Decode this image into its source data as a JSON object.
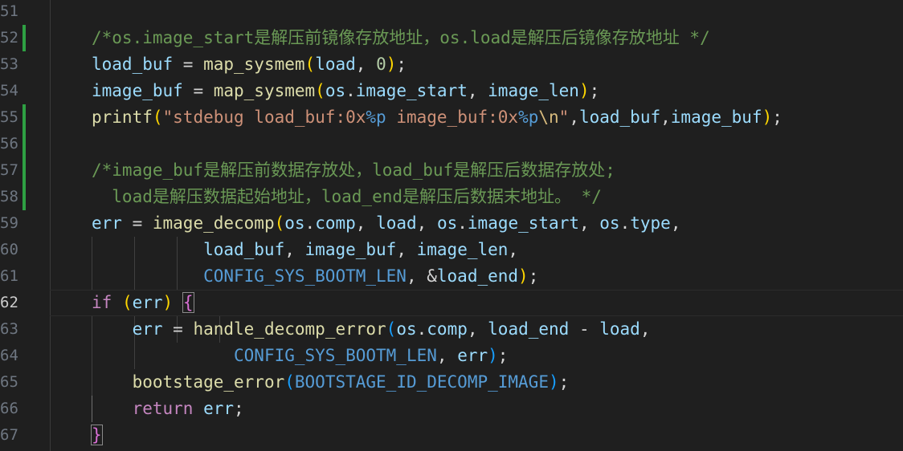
{
  "colors": {
    "background": "#1f1f1f",
    "line_number": "#6e7681",
    "line_number_active": "#cccccc",
    "git_added": "#2ea043",
    "variable": "#9cdcfe",
    "function": "#dcdcaa",
    "string": "#ce9178",
    "comment": "#6a9955",
    "keyword": "#c586c0",
    "macro": "#4fc1ff"
  },
  "editor": {
    "lines": [
      {
        "number": "51",
        "tokens": []
      },
      {
        "number": "52",
        "git_added": true,
        "tokens": [
          {
            "text": "/*os.image_start是解压前镜像存放地址，os.load是解压后镜像存放地址 */",
            "cls": "t-com"
          }
        ]
      },
      {
        "number": "53",
        "tokens": [
          {
            "text": "load_buf",
            "cls": "t-var"
          },
          {
            "text": " = ",
            "cls": "t-op"
          },
          {
            "text": "map_sysmem",
            "cls": "t-fn"
          },
          {
            "text": "(",
            "cls": "t-p1"
          },
          {
            "text": "load",
            "cls": "t-var"
          },
          {
            "text": ", ",
            "cls": "t-op"
          },
          {
            "text": "0",
            "cls": "t-num"
          },
          {
            "text": ")",
            "cls": "t-p1"
          },
          {
            "text": ";",
            "cls": "t-op"
          }
        ]
      },
      {
        "number": "54",
        "tokens": [
          {
            "text": "image_buf",
            "cls": "t-var"
          },
          {
            "text": " = ",
            "cls": "t-op"
          },
          {
            "text": "map_sysmem",
            "cls": "t-fn"
          },
          {
            "text": "(",
            "cls": "t-p1"
          },
          {
            "text": "os",
            "cls": "t-var"
          },
          {
            "text": ".",
            "cls": "t-op"
          },
          {
            "text": "image_start",
            "cls": "t-var"
          },
          {
            "text": ", ",
            "cls": "t-op"
          },
          {
            "text": "image_len",
            "cls": "t-var"
          },
          {
            "text": ")",
            "cls": "t-p1"
          },
          {
            "text": ";",
            "cls": "t-op"
          }
        ]
      },
      {
        "number": "55",
        "git_added": true,
        "tokens": [
          {
            "text": "printf",
            "cls": "t-fn"
          },
          {
            "text": "(",
            "cls": "t-p1"
          },
          {
            "text": "\"stdebug load_buf:0x",
            "cls": "t-str"
          },
          {
            "text": "%p",
            "cls": "t-macro"
          },
          {
            "text": " image_buf:0x",
            "cls": "t-str"
          },
          {
            "text": "%p",
            "cls": "t-macro"
          },
          {
            "text": "\\n",
            "cls": "t-esc"
          },
          {
            "text": "\"",
            "cls": "t-str"
          },
          {
            "text": ",",
            "cls": "t-op"
          },
          {
            "text": "load_buf",
            "cls": "t-var"
          },
          {
            "text": ",",
            "cls": "t-op"
          },
          {
            "text": "image_buf",
            "cls": "t-var"
          },
          {
            "text": ")",
            "cls": "t-p1"
          },
          {
            "text": ";",
            "cls": "t-op"
          }
        ]
      },
      {
        "number": "56",
        "git_added": true,
        "tokens": []
      },
      {
        "number": "57",
        "git_added": true,
        "tokens": [
          {
            "text": "/*image_buf是解压前数据存放处，load_buf是解压后数据存放处;",
            "cls": "t-com"
          }
        ]
      },
      {
        "number": "58",
        "git_added": true,
        "tokens": [
          {
            "text": "  load是解压数据起始地址，load_end是解压后数据末地址。 */",
            "cls": "t-com"
          }
        ]
      },
      {
        "number": "59",
        "tokens": [
          {
            "text": "err",
            "cls": "t-var"
          },
          {
            "text": " = ",
            "cls": "t-op"
          },
          {
            "text": "image_decomp",
            "cls": "t-fn"
          },
          {
            "text": "(",
            "cls": "t-p1"
          },
          {
            "text": "os",
            "cls": "t-var"
          },
          {
            "text": ".",
            "cls": "t-op"
          },
          {
            "text": "comp",
            "cls": "t-var"
          },
          {
            "text": ", ",
            "cls": "t-op"
          },
          {
            "text": "load",
            "cls": "t-var"
          },
          {
            "text": ", ",
            "cls": "t-op"
          },
          {
            "text": "os",
            "cls": "t-var"
          },
          {
            "text": ".",
            "cls": "t-op"
          },
          {
            "text": "image_start",
            "cls": "t-var"
          },
          {
            "text": ", ",
            "cls": "t-op"
          },
          {
            "text": "os",
            "cls": "t-var"
          },
          {
            "text": ".",
            "cls": "t-op"
          },
          {
            "text": "type",
            "cls": "t-var"
          },
          {
            "text": ",",
            "cls": "t-op"
          }
        ]
      },
      {
        "number": "60",
        "tokens": [
          {
            "text": "           ",
            "cls": "t-op"
          },
          {
            "text": "load_buf",
            "cls": "t-var"
          },
          {
            "text": ", ",
            "cls": "t-op"
          },
          {
            "text": "image_buf",
            "cls": "t-var"
          },
          {
            "text": ", ",
            "cls": "t-op"
          },
          {
            "text": "image_len",
            "cls": "t-var"
          },
          {
            "text": ",",
            "cls": "t-op"
          }
        ]
      },
      {
        "number": "61",
        "tokens": [
          {
            "text": "           ",
            "cls": "t-op"
          },
          {
            "text": "CONFIG_SYS_BOOTM_LEN",
            "cls": "t-macro"
          },
          {
            "text": ", &",
            "cls": "t-op"
          },
          {
            "text": "load_end",
            "cls": "t-var"
          },
          {
            "text": ")",
            "cls": "t-p1"
          },
          {
            "text": ";",
            "cls": "t-op"
          }
        ]
      },
      {
        "number": "62",
        "current": true,
        "tokens": [
          {
            "text": "if",
            "cls": "t-kw"
          },
          {
            "text": " ",
            "cls": "t-op"
          },
          {
            "text": "(",
            "cls": "t-p1"
          },
          {
            "text": "err",
            "cls": "t-var"
          },
          {
            "text": ")",
            "cls": "t-p1"
          },
          {
            "text": " ",
            "cls": "t-op"
          },
          {
            "text": "{",
            "cls": "t-p2",
            "match": true
          }
        ]
      },
      {
        "number": "63",
        "tokens": [
          {
            "text": "    ",
            "cls": "t-op"
          },
          {
            "text": "err",
            "cls": "t-var"
          },
          {
            "text": " = ",
            "cls": "t-op"
          },
          {
            "text": "handle_decomp_error",
            "cls": "t-fn"
          },
          {
            "text": "(",
            "cls": "t-p3"
          },
          {
            "text": "os",
            "cls": "t-var"
          },
          {
            "text": ".",
            "cls": "t-op"
          },
          {
            "text": "comp",
            "cls": "t-var"
          },
          {
            "text": ", ",
            "cls": "t-op"
          },
          {
            "text": "load_end",
            "cls": "t-var"
          },
          {
            "text": " - ",
            "cls": "t-op"
          },
          {
            "text": "load",
            "cls": "t-var"
          },
          {
            "text": ",",
            "cls": "t-op"
          }
        ]
      },
      {
        "number": "64",
        "tokens": [
          {
            "text": "              ",
            "cls": "t-op"
          },
          {
            "text": "CONFIG_SYS_BOOTM_LEN",
            "cls": "t-macro"
          },
          {
            "text": ", ",
            "cls": "t-op"
          },
          {
            "text": "err",
            "cls": "t-var"
          },
          {
            "text": ")",
            "cls": "t-p3"
          },
          {
            "text": ";",
            "cls": "t-op"
          }
        ]
      },
      {
        "number": "65",
        "tokens": [
          {
            "text": "    ",
            "cls": "t-op"
          },
          {
            "text": "bootstage_error",
            "cls": "t-fn"
          },
          {
            "text": "(",
            "cls": "t-p3"
          },
          {
            "text": "BOOTSTAGE_ID_DECOMP_IMAGE",
            "cls": "t-macro"
          },
          {
            "text": ")",
            "cls": "t-p3"
          },
          {
            "text": ";",
            "cls": "t-op"
          }
        ]
      },
      {
        "number": "66",
        "tokens": [
          {
            "text": "    ",
            "cls": "t-op"
          },
          {
            "text": "return",
            "cls": "t-kw"
          },
          {
            "text": " ",
            "cls": "t-op"
          },
          {
            "text": "err",
            "cls": "t-var"
          },
          {
            "text": ";",
            "cls": "t-op"
          }
        ]
      },
      {
        "number": "67",
        "tokens": [
          {
            "text": "}",
            "cls": "t-p2",
            "match": true
          }
        ]
      }
    ]
  }
}
